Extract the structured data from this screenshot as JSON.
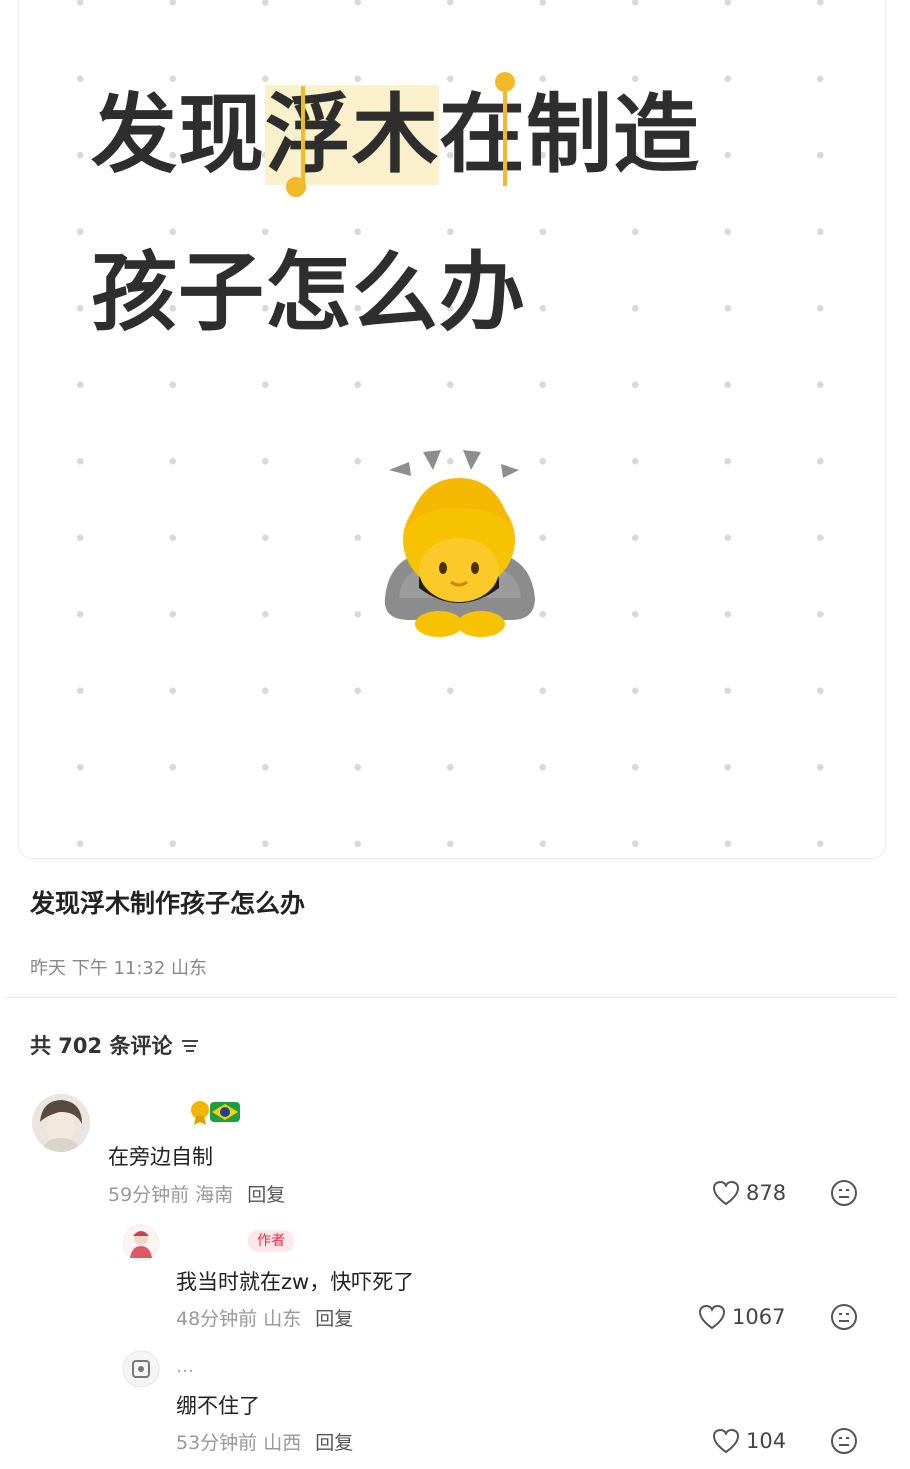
{
  "note": {
    "image_line1_pre": "发现",
    "image_line1_highlight": "浮木",
    "image_line1_post": "在制造",
    "image_line2": "孩子怎么办",
    "emoji": "person-bowing-emoji",
    "title": "发现浮木制作孩子怎么办",
    "meta": "昨天 下午 11:32 山东"
  },
  "comments_header": {
    "label": "共 702 条评论",
    "filter_icon": "filter-icon"
  },
  "comments": [
    {
      "badge_icons": [
        "medal-icon",
        "brazil-flag-icon"
      ],
      "text": "在旁边自制",
      "time": "59分钟前",
      "location": "海南",
      "reply_label": "回复",
      "likes": "878",
      "replies": [
        {
          "author_badge": "作者",
          "text": "我当时就在zw，快吓死了",
          "time": "48分钟前",
          "location": "山东",
          "reply_label": "回复",
          "likes": "1067"
        },
        {
          "name_partial": "…",
          "text": "绷不住了",
          "time": "53分钟前",
          "location": "山西",
          "reply_label": "回复",
          "likes": "104"
        }
      ]
    }
  ]
}
